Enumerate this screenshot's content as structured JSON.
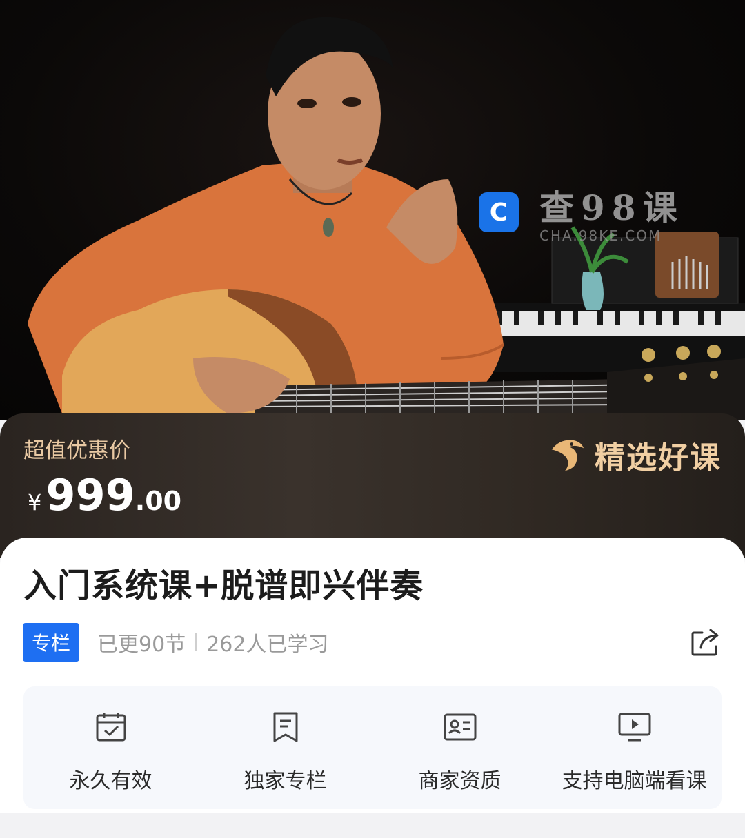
{
  "watermark": {
    "logo_glyph": "C",
    "title": "查98课",
    "url": "CHA.98KE.COM"
  },
  "price": {
    "label": "超值优惠价",
    "currency": "¥",
    "integer": "999",
    "decimal": ".00"
  },
  "badge": {
    "text": "精选好课"
  },
  "course": {
    "title": "入门系统课+脱谱即兴伴奏",
    "tag": "专栏",
    "updated": "已更90节",
    "learners": "262人已学习"
  },
  "features": [
    {
      "icon": "calendar-check-icon",
      "label": "永久有效"
    },
    {
      "icon": "bookmark-column-icon",
      "label": "独家专栏"
    },
    {
      "icon": "id-card-icon",
      "label": "商家资质"
    },
    {
      "icon": "monitor-play-icon",
      "label": "支持电脑端看课"
    }
  ],
  "colors": {
    "accent_blue": "#1e6ff2",
    "gold": "#e9c9a3",
    "shirt": "#d9743c"
  }
}
